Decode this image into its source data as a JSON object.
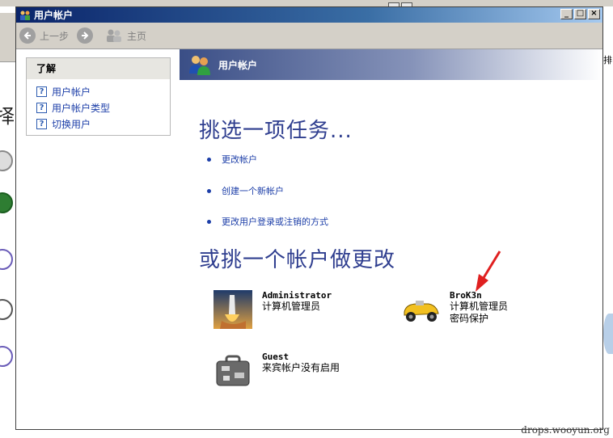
{
  "window": {
    "title": "用户帐户"
  },
  "toolbar": {
    "back_label": "上一步",
    "home_label": "主页"
  },
  "learn": {
    "heading": "了解",
    "items": [
      {
        "label": "用户帐户"
      },
      {
        "label": "用户帐户类型"
      },
      {
        "label": "切换用户"
      }
    ]
  },
  "banner": {
    "title": "用户帐户"
  },
  "tasks": {
    "heading": "挑选一项任务...",
    "items": [
      {
        "label": "更改帐户"
      },
      {
        "label": "创建一个新帐户"
      },
      {
        "label": "更改用户登录或注销的方式"
      }
    ]
  },
  "accounts": {
    "heading": "或挑一个帐户做更改",
    "items": [
      {
        "name": "Administrator",
        "desc": "计算机管理员",
        "desc2": ""
      },
      {
        "name": "BroK3n",
        "desc": "计算机管理员",
        "desc2": "密码保护"
      },
      {
        "name": "Guest",
        "desc": "来宾帐户没有启用",
        "desc2": ""
      }
    ]
  },
  "background": {
    "right_char": "排",
    "left_big_char": "择"
  },
  "watermark": "drops.wooyun.org"
}
